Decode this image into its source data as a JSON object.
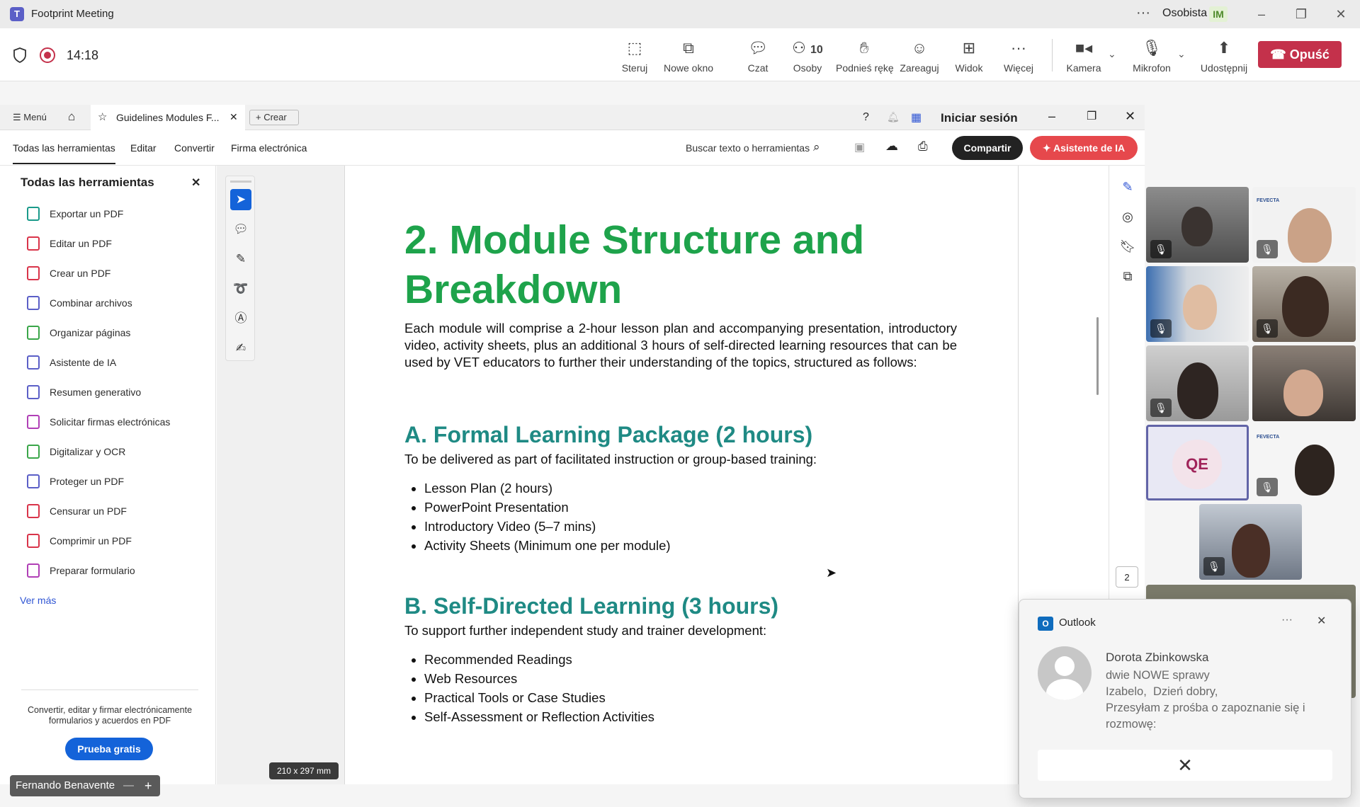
{
  "teams": {
    "window_title": "Footprint Meeting",
    "profile_label": "Osobista",
    "profile_initials": "IM",
    "timer": "14:18",
    "people_count": "10",
    "toolbar": {
      "steruj": "Steruj",
      "nowe_okno": "Nowe okno",
      "czat": "Czat",
      "osoby": "Osoby",
      "podnies": "Podnieś rękę",
      "zareaguj": "Zareaguj",
      "widok": "Widok",
      "wiecej": "Więcej",
      "kamera": "Kamera",
      "mikrofon": "Mikrofon",
      "udostepnij": "Udostępnij",
      "opusc": "Opuść"
    }
  },
  "acrobat": {
    "menu_label": "Menú",
    "tab_title": "Guidelines Modules F...",
    "new_tab": "Crear",
    "sign_in": "Iniciar sesión",
    "nav": [
      "Todas las herramientas",
      "Editar",
      "Convertir",
      "Firma electrónica"
    ],
    "search_placeholder": "Buscar texto o herramientas",
    "share": "Compartir",
    "ai_assistant": "Asistente de IA",
    "panel_title": "Todas las herramientas",
    "panel_items": [
      {
        "label": "Exportar un PDF",
        "color": "#1a9a8a"
      },
      {
        "label": "Editar un PDF",
        "color": "#d9344a"
      },
      {
        "label": "Crear un PDF",
        "color": "#d9344a"
      },
      {
        "label": "Combinar archivos",
        "color": "#5b5fc7"
      },
      {
        "label": "Organizar páginas",
        "color": "#3aa649"
      },
      {
        "label": "Asistente de IA",
        "color": "#5b5fc7"
      },
      {
        "label": "Resumen generativo",
        "color": "#5b5fc7"
      },
      {
        "label": "Solicitar firmas electrónicas",
        "color": "#b03fb6"
      },
      {
        "label": "Digitalizar y OCR",
        "color": "#3aa649"
      },
      {
        "label": "Proteger un PDF",
        "color": "#5b5fc7"
      },
      {
        "label": "Censurar un PDF",
        "color": "#d9344a"
      },
      {
        "label": "Comprimir un PDF",
        "color": "#d9344a"
      },
      {
        "label": "Preparar formulario",
        "color": "#b03fb6"
      }
    ],
    "see_more": "Ver más",
    "promo_text": "Convertir, editar y firmar electrónicamente formularios y acuerdos en PDF",
    "trial_button": "Prueba gratis",
    "page_size": "210 x 297 mm",
    "page_number": "2"
  },
  "document": {
    "heading": "2. Module Structure and Breakdown",
    "intro": "Each module will comprise a 2-hour lesson plan and accompanying presentation, introductory video, activity sheets, plus an additional 3 hours of self-directed learning resources that can be used by VET educators to further their understanding of the topics, structured as follows:",
    "sectionA_title": "A. Formal Learning Package (2 hours)",
    "sectionA_intro": "To be delivered as part of facilitated instruction or group-based training:",
    "sectionA_items": [
      "Lesson Plan (2 hours)",
      "PowerPoint Presentation",
      "Introductory Video (5–7 mins)",
      "Activity Sheets (Minimum one per module)"
    ],
    "sectionB_title": "B. Self-Directed Learning (3 hours)",
    "sectionB_intro": "To support further independent study and trainer development:",
    "sectionB_items": [
      "Recommended Readings",
      "Web Resources",
      "Practical Tools or Case Studies",
      "Self-Assessment or Reflection Activities"
    ]
  },
  "participants": {
    "qe_initials": "QE",
    "fevecta_label": "FEVECTA",
    "presenter_name": "Fernando Benavente"
  },
  "notification": {
    "app": "Outlook",
    "sender": "Dorota Zbinkowska",
    "subject": "dwie NOWE sprawy",
    "greeting": "Izabelo,  Dzień dobry,",
    "preview": "Przesyłam z prośba o zapoznanie się i rozmowę:"
  }
}
